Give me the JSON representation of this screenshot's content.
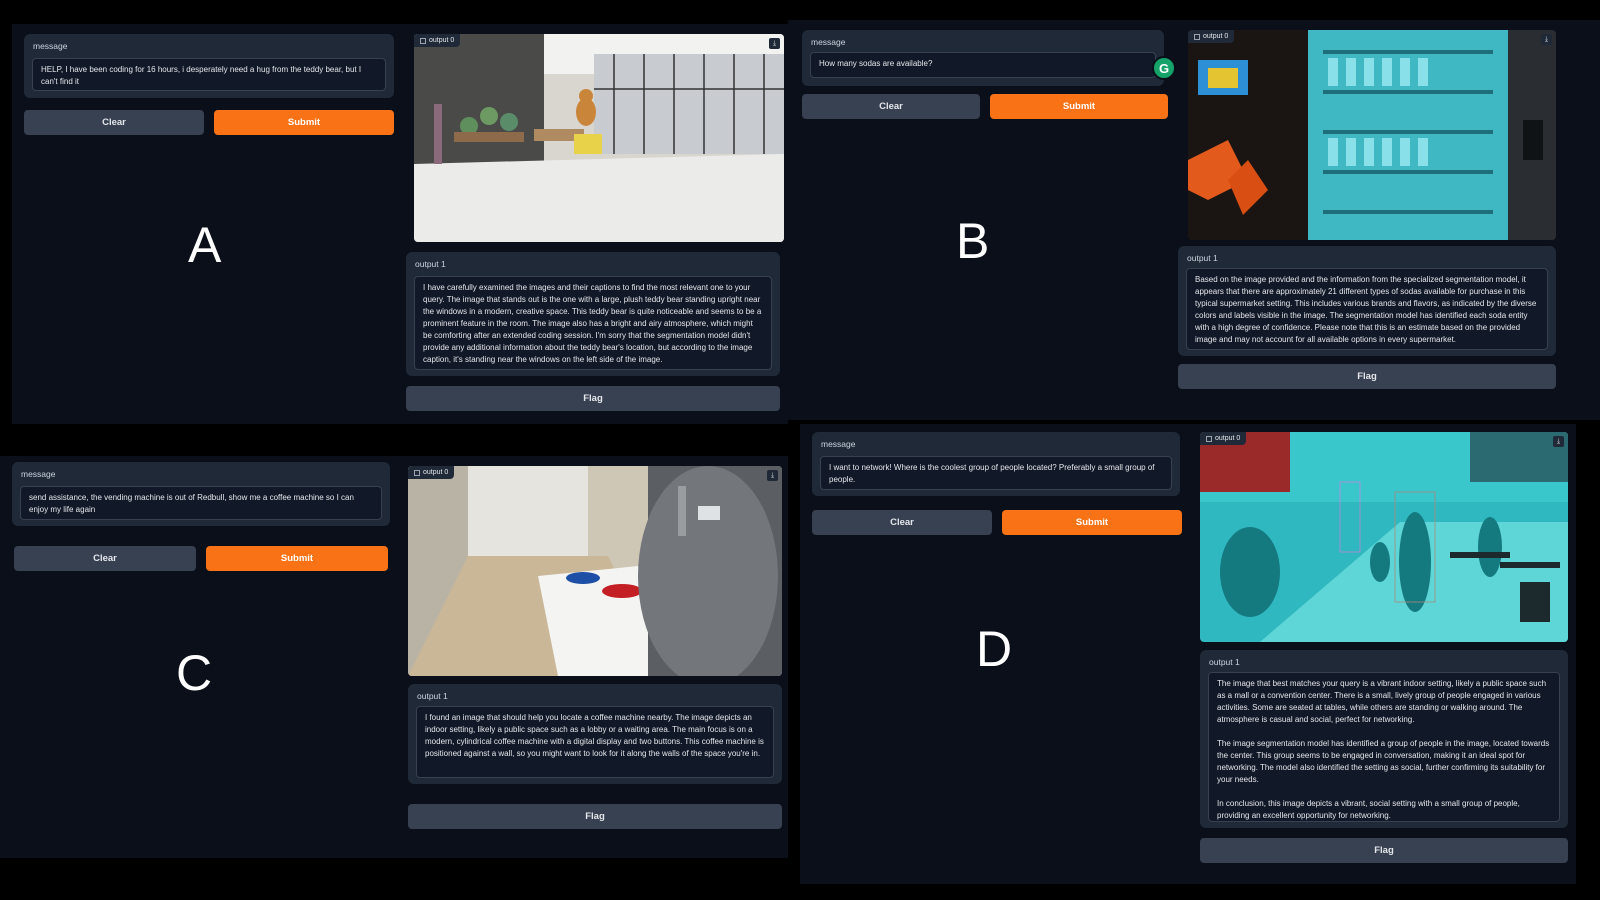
{
  "common": {
    "message_label": "message",
    "output0_label": "output 0",
    "output1_label": "output 1",
    "clear_label": "Clear",
    "submit_label": "Submit",
    "flag_label": "Flag"
  },
  "panels": {
    "a": {
      "letter": "A",
      "message": "HELP, I have been coding for 16 hours, i desperately need a hug from the teddy bear, but I can't find it",
      "output1": "I have carefully examined the images and their captions to find the most relevant one to your query. The image that stands out is the one with a large, plush teddy bear standing upright near the windows in a modern, creative space. This teddy bear is quite noticeable and seems to be a prominent feature in the room. The image also has a bright and airy atmosphere, which might be comforting after an extended coding session. I'm sorry that the segmentation model didn't provide any additional information about the teddy bear's location, but according to the image caption, it's standing near the windows on the left side of the image."
    },
    "b": {
      "letter": "B",
      "message": "How many sodas are available?",
      "output1": "Based on the image provided and the information from the specialized segmentation model, it appears that there are approximately 21 different types of sodas available for purchase in this typical supermarket setting. This includes various brands and flavors, as indicated by the diverse colors and labels visible in the image. The segmentation model has identified each soda entity with a high degree of confidence. Please note that this is an estimate based on the provided image and may not account for all available options in every supermarket."
    },
    "c": {
      "letter": "C",
      "message": "send assistance, the vending machine is out of Redbull, show me a coffee machine so I can enjoy my life again",
      "output1": "I found an image that should help you locate a coffee machine nearby. The image depicts an indoor setting, likely a public space such as a lobby or a waiting area. The main focus is on a modern, cylindrical coffee machine with a digital display and two buttons. This coffee machine is positioned against a wall, so you might want to look for it along the walls of the space you're in."
    },
    "d": {
      "letter": "D",
      "message": "I want to network! Where is the coolest group of people located? Preferably a small group of people.",
      "output1": "The image that best matches your query is a vibrant indoor setting, likely a public space such as a mall or a convention center. There is a small, lively group of people engaged in various activities. Some are seated at tables, while others are standing or walking around. The atmosphere is casual and social, perfect for networking.\n\nThe image segmentation model has identified a group of people in the image, located towards the center. This group seems to be engaged in conversation, making it an ideal spot for networking. The model also identified the setting as social, further confirming its suitability for your needs.\n\nIn conclusion, this image depicts a vibrant, social setting with a small group of people, providing an excellent opportunity for networking."
    }
  }
}
